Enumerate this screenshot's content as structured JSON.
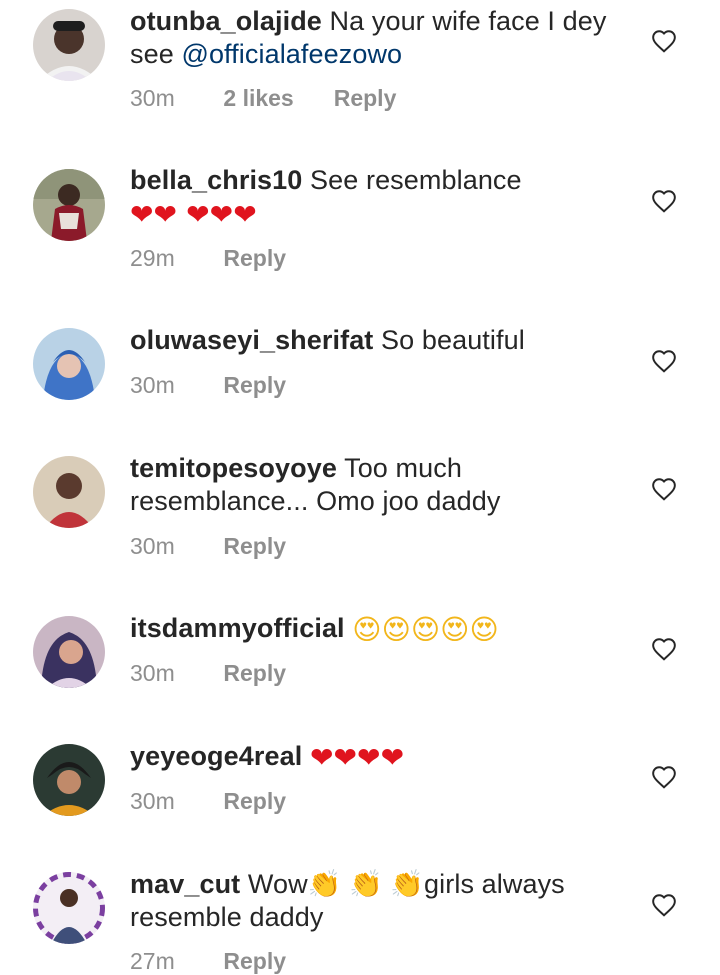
{
  "comments": [
    {
      "username": "otunba_olajide",
      "text": "Na your wife face I dey see ",
      "mention": "@officialafeezowo",
      "emojis": "",
      "time": "30m",
      "likes": "2 likes",
      "reply": "Reply",
      "avatar_color": "#c9c4c0"
    },
    {
      "username": "bella_chris10",
      "text": "See resemblance ",
      "mention": "",
      "emojis": "❤❤ ❤❤❤",
      "time": "29m",
      "likes": "",
      "reply": "Reply",
      "avatar_color": "#9aa08a"
    },
    {
      "username": "oluwaseyi_sherifat",
      "text": "So beautiful",
      "mention": "",
      "emojis": "",
      "time": "30m",
      "likes": "",
      "reply": "Reply",
      "avatar_color": "#a9c6df"
    },
    {
      "username": "temitopesoyoye",
      "text": "Too much resemblance... Omo joo daddy",
      "mention": "",
      "emojis": "",
      "time": "30m",
      "likes": "",
      "reply": "Reply",
      "avatar_color": "#c86a64"
    },
    {
      "username": "itsdammyofficial",
      "text": "",
      "mention": "",
      "emojis": "😍😍😍😍😍",
      "time": "30m",
      "likes": "",
      "reply": "Reply",
      "avatar_color": "#b8a3b8"
    },
    {
      "username": "yeyeoge4real",
      "text": "",
      "mention": "",
      "emojis": "❤❤❤❤",
      "time": "30m",
      "likes": "",
      "reply": "Reply",
      "avatar_color": "#2c3a36"
    },
    {
      "username": "mav_cut",
      "text": "Wow👏 👏 👏girls always resemble daddy",
      "mention": "",
      "emojis": "",
      "time": "27m",
      "likes": "",
      "reply": "Reply",
      "avatar_color": "#7b3fa0"
    }
  ],
  "icons": {
    "like": "heart-outline-icon"
  },
  "colors": {
    "text": "#262626",
    "meta": "#8e8e8e",
    "mention": "#00376b",
    "heart_emoji": "#e0141e"
  }
}
